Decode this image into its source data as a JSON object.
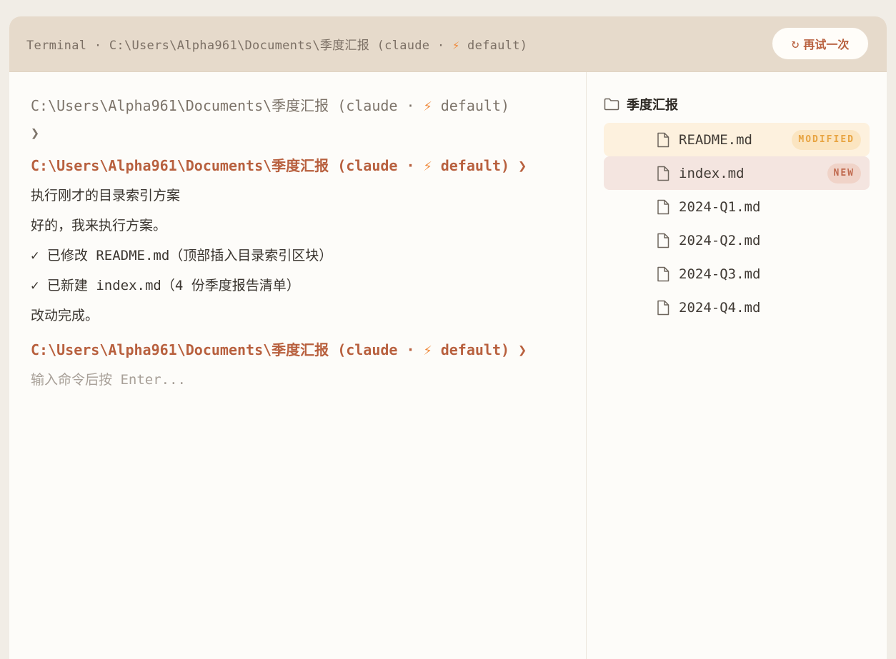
{
  "header": {
    "title_prefix": "Terminal · C:\\Users\\Alpha961\\Documents\\季度汇报 (claude · ",
    "title_suffix": " default)",
    "retry_icon": "↻",
    "retry_label": "再试一次"
  },
  "terminal": {
    "prompt_prefix": "C:\\Users\\Alpha961\\Documents\\季度汇报 (claude · ",
    "prompt_suffix": " default)",
    "prompt_arrow": "❯",
    "command": "执行刚才的目录索引方案",
    "responses": [
      "好的，我来执行方案。",
      "✓ 已修改 README.md（顶部插入目录索引区块）",
      "✓ 已新建 index.md（4 份季度报告清单）",
      "改动完成。"
    ],
    "input_placeholder": "输入命令后按 Enter..."
  },
  "file_tree": {
    "folder": "季度汇报",
    "files": [
      {
        "name": "README.md",
        "badge": "MODIFIED"
      },
      {
        "name": "index.md",
        "badge": "NEW"
      },
      {
        "name": "2024-Q1.md",
        "badge": ""
      },
      {
        "name": "2024-Q2.md",
        "badge": ""
      },
      {
        "name": "2024-Q3.md",
        "badge": ""
      },
      {
        "name": "2024-Q4.md",
        "badge": ""
      }
    ]
  },
  "icons": {
    "bolt": "lightning-icon",
    "folder": "folder-icon",
    "file": "file-icon",
    "retry": "refresh-icon"
  },
  "colors": {
    "accent": "#b8603e",
    "bolt": "#ef8a3c",
    "header_bg": "#e6dacb",
    "modified_bg": "#fdf1de",
    "new_bg": "#f4e5e0"
  }
}
